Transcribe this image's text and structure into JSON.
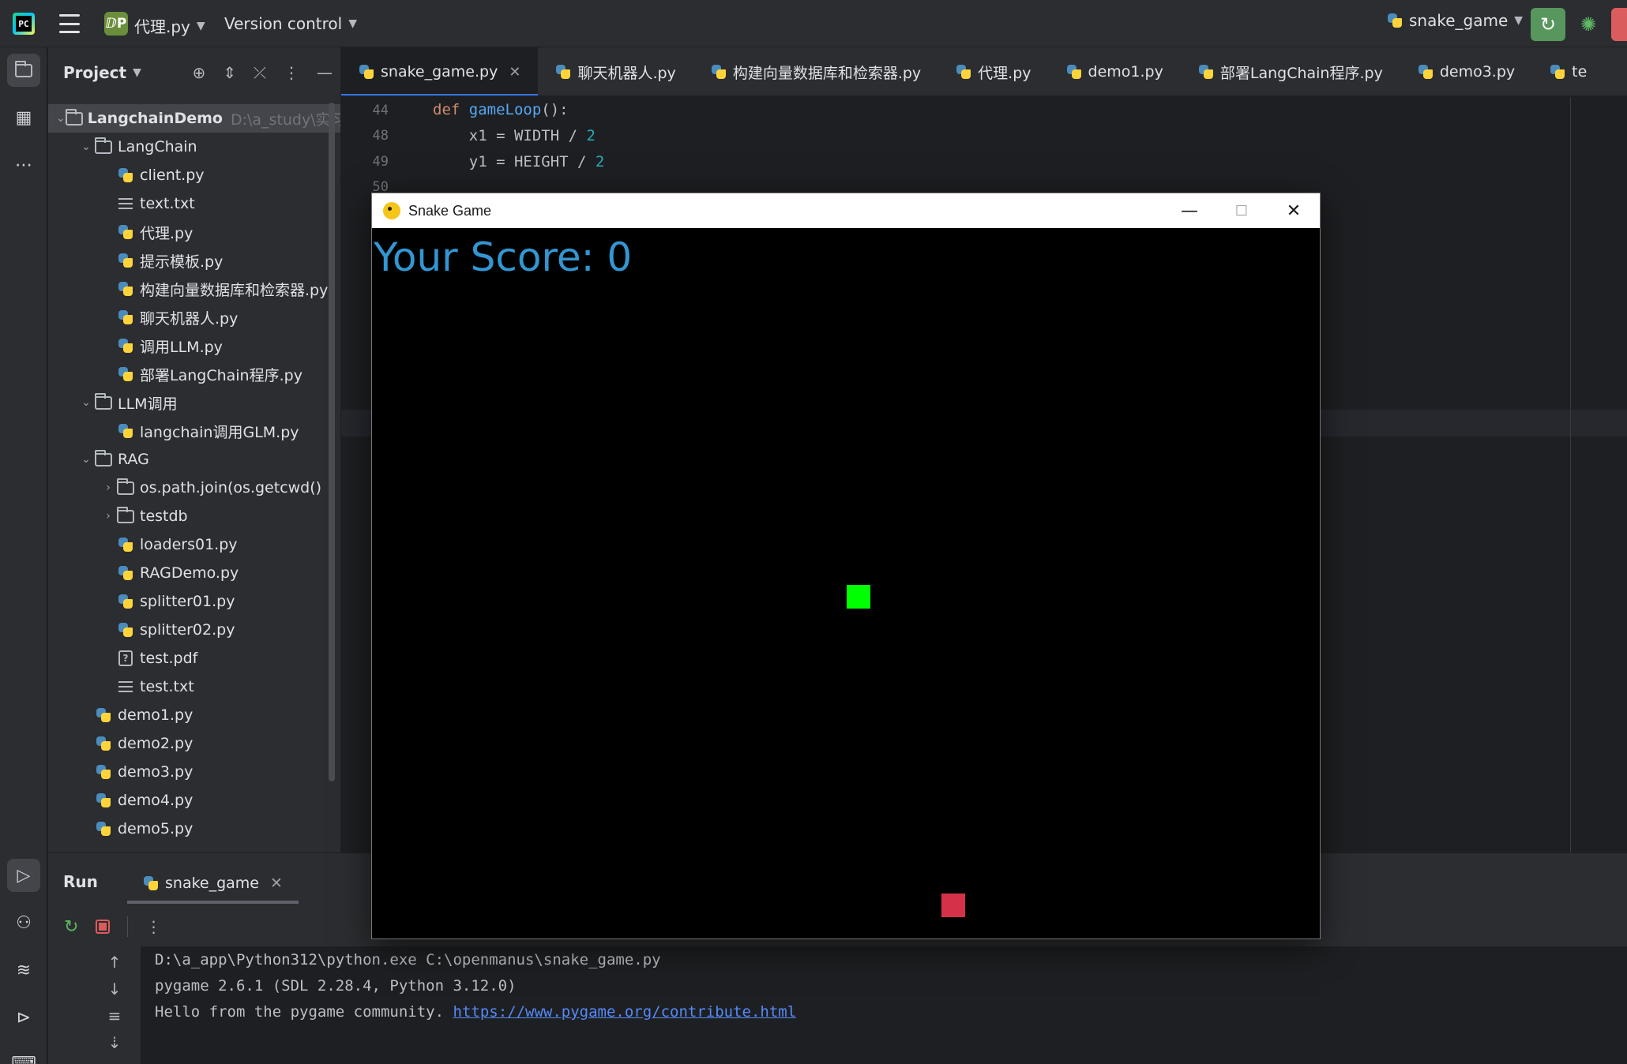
{
  "titlebar": {
    "project_badge": "ⅅP",
    "project_name": "代理.py",
    "version_control": "Version control",
    "run_config": "snake_game"
  },
  "project_panel": {
    "title": "Project",
    "tree": [
      {
        "label": "LangchainDemo",
        "hint": "D:\\a_study\\实习",
        "type": "folder",
        "level": 0,
        "expanded": true
      },
      {
        "label": "LangChain",
        "type": "folder",
        "level": 1,
        "expanded": true
      },
      {
        "label": "client.py",
        "type": "py",
        "level": 2
      },
      {
        "label": "text.txt",
        "type": "txt",
        "level": 2
      },
      {
        "label": "代理.py",
        "type": "py",
        "level": 2
      },
      {
        "label": "提示模板.py",
        "type": "py",
        "level": 2
      },
      {
        "label": "构建向量数据库和检索器.py",
        "type": "py",
        "level": 2
      },
      {
        "label": "聊天机器人.py",
        "type": "py",
        "level": 2
      },
      {
        "label": "调用LLM.py",
        "type": "py",
        "level": 2
      },
      {
        "label": "部署LangChain程序.py",
        "type": "py",
        "level": 2
      },
      {
        "label": "LLM调用",
        "type": "folder",
        "level": 1,
        "expanded": true
      },
      {
        "label": "langchain调用GLM.py",
        "type": "py",
        "level": 2
      },
      {
        "label": "RAG",
        "type": "folder",
        "level": 1,
        "expanded": true
      },
      {
        "label": "os.path.join(os.getcwd()",
        "type": "folder",
        "level": 2,
        "expanded": false
      },
      {
        "label": "testdb",
        "type": "folder",
        "level": 2,
        "expanded": false
      },
      {
        "label": "loaders01.py",
        "type": "py",
        "level": 2
      },
      {
        "label": "RAGDemo.py",
        "type": "py",
        "level": 2
      },
      {
        "label": "splitter01.py",
        "type": "py",
        "level": 2
      },
      {
        "label": "splitter02.py",
        "type": "py",
        "level": 2
      },
      {
        "label": "test.pdf",
        "type": "pdf",
        "level": 2
      },
      {
        "label": "test.txt",
        "type": "txt",
        "level": 2
      },
      {
        "label": "demo1.py",
        "type": "py",
        "level": 1
      },
      {
        "label": "demo2.py",
        "type": "py",
        "level": 1
      },
      {
        "label": "demo3.py",
        "type": "py",
        "level": 1
      },
      {
        "label": "demo4.py",
        "type": "py",
        "level": 1
      },
      {
        "label": "demo5.py",
        "type": "py",
        "level": 1
      }
    ]
  },
  "tabs": [
    {
      "label": "snake_game.py",
      "active": true
    },
    {
      "label": "聊天机器人.py"
    },
    {
      "label": "构建向量数据库和检索器.py"
    },
    {
      "label": "代理.py"
    },
    {
      "label": "demo1.py"
    },
    {
      "label": "部署LangChain程序.py"
    },
    {
      "label": "demo3.py"
    },
    {
      "label": "te"
    }
  ],
  "editor": {
    "lines": [
      {
        "num": "44",
        "kw": "def ",
        "fn": "gameLoop",
        "rest": "():"
      },
      {
        "num": "48",
        "text": "    x1 = WIDTH / ",
        "num_lit": "2"
      },
      {
        "num": "49",
        "text": "    y1 = HEIGHT / ",
        "num_lit": "2"
      },
      {
        "num": "50"
      }
    ]
  },
  "game_window": {
    "title": "Snake Game",
    "minimize": "—",
    "maximize": "☐",
    "close": "✕",
    "score_text": "Your Score: 0",
    "colors": {
      "snake": "#00ff00",
      "food": "#d5324a",
      "score": "#3296d2",
      "background": "#000000"
    }
  },
  "run_panel": {
    "title": "Run",
    "tab_label": "snake_game",
    "console": [
      "D:\\a_app\\Python312\\python.exe C:\\openmanus\\snake_game.py",
      "pygame 2.6.1 (SDL 2.28.4, Python 3.12.0)",
      "Hello from the pygame community. "
    ],
    "console_link": "https://www.pygame.org/contribute.html"
  }
}
